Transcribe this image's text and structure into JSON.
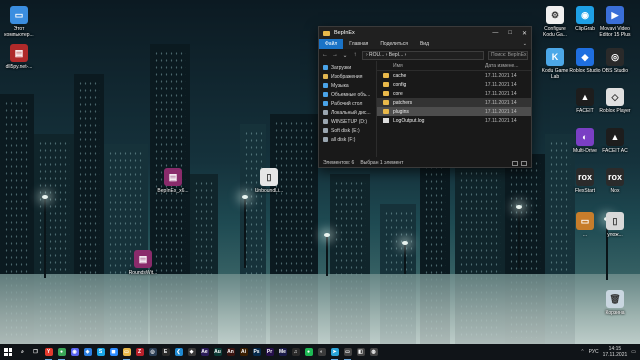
{
  "desktop": {
    "left_icons": [
      {
        "label": "Этот компьютер...",
        "color": "#3b8ee0",
        "glyph": "▭"
      },
      {
        "label": "dll5py.net-...",
        "color": "#b02a2a",
        "glyph": "▤"
      }
    ],
    "middle_icons": [
      {
        "label": "BepInEx_x6...",
        "color": "#8a2b6b",
        "glyph": "▤"
      },
      {
        "label": "UnboundLi...",
        "color": "#e6e6e6",
        "glyph": "▯"
      },
      {
        "label": "RoundsWit...",
        "color": "#8a2b6b",
        "glyph": "▤"
      }
    ],
    "right_icons": [
      {
        "label": "Configure Kodu Ga...",
        "color": "#f0f0f0",
        "glyph": "⚙"
      },
      {
        "label": "ClipGrab",
        "color": "#1ea0e6",
        "glyph": "◉"
      },
      {
        "label": "Movavi Video Editor 15 Plus",
        "color": "#3a6fd8",
        "glyph": "▶"
      },
      {
        "label": "Kodu Game Lab",
        "color": "#4ca8e8",
        "glyph": "K"
      },
      {
        "label": "Roblox Studio",
        "color": "#1f6fe0",
        "glyph": "◆"
      },
      {
        "label": "OBS Studio",
        "color": "#2a2a2a",
        "glyph": "◎"
      },
      {
        "label": "FACEIT",
        "color": "#1d1d1d",
        "glyph": "▲"
      },
      {
        "label": "Roblox Player",
        "color": "#e0e0e0",
        "glyph": "◇"
      },
      {
        "label": "Multi-Drive",
        "color": "#7a3fc4",
        "glyph": "◐"
      },
      {
        "label": "FACEIT AC",
        "color": "#1d1d1d",
        "glyph": "▲"
      },
      {
        "label": "FlexStart",
        "color": "#2b2b2b",
        "glyph": "rox"
      },
      {
        "label": "Nox",
        "color": "#2b2b2b",
        "glyph": "rox"
      },
      {
        "label": "...",
        "color": "#c77d2b",
        "glyph": "▭"
      },
      {
        "label": "улож...",
        "color": "#d8d8d8",
        "glyph": "▯"
      },
      {
        "label": "Корзина",
        "color": "#c9d6e0",
        "glyph": "🗑"
      }
    ]
  },
  "explorer": {
    "title": "BepInEx",
    "window_buttons": [
      "—",
      "□",
      "✕"
    ],
    "ribbon_tabs": [
      "Файл",
      "Главная",
      "Поделиться",
      "Вид"
    ],
    "address": "›  ROU...  ›  BepI...  ›",
    "search_placeholder": "Поиск: BepInEx",
    "nav_items": [
      {
        "label": "Загрузки",
        "color": "#4aa3e8"
      },
      {
        "label": "Изображения",
        "color": "#e2b650"
      },
      {
        "label": "Музыка",
        "color": "#4aa3e8"
      },
      {
        "label": "Объемные объ...",
        "color": "#4aa3e8"
      },
      {
        "label": "Рабочий стол",
        "color": "#4aa3e8"
      },
      {
        "label": "Локальный дис...",
        "color": "#9aa6b0"
      },
      {
        "label": "WINSETUP (D:)",
        "color": "#9aa6b0"
      },
      {
        "label": "Soft disk (E:)",
        "color": "#9aa6b0"
      },
      {
        "label": "all disk (F:)",
        "color": "#9aa6b0"
      }
    ],
    "columns": {
      "name": "Имя",
      "date": "Дата измене..."
    },
    "files": [
      {
        "name": "cache",
        "date": "17.11.2021 14",
        "type": "folder"
      },
      {
        "name": "config",
        "date": "17.11.2021 14",
        "type": "folder"
      },
      {
        "name": "core",
        "date": "17.11.2021 14",
        "type": "folder"
      },
      {
        "name": "patchers",
        "date": "17.11.2021 14",
        "type": "folder"
      },
      {
        "name": "plugins",
        "date": "17.11.2021 14",
        "type": "folder"
      },
      {
        "name": "LogOutput.log",
        "date": "17.11.2021 14",
        "type": "file"
      }
    ],
    "status": {
      "count": "Элементов: 6",
      "selected": "Выбран 1 элемент"
    }
  },
  "taskbar": {
    "apps": [
      {
        "name": "search-icon",
        "color": "#101418",
        "glyph": "⌕"
      },
      {
        "name": "task-view-icon",
        "color": "#101418",
        "glyph": "❐"
      },
      {
        "name": "yandex-browser-icon",
        "color": "#e23a2e",
        "glyph": "Y"
      },
      {
        "name": "chrome-icon",
        "color": "#3aa757",
        "glyph": "●"
      },
      {
        "name": "discord-icon",
        "color": "#5865f2",
        "glyph": "◉"
      },
      {
        "name": "vk-icon",
        "color": "#2d7fe0",
        "glyph": "◈"
      },
      {
        "name": "skype-icon",
        "color": "#1aa7e8",
        "glyph": "S"
      },
      {
        "name": "zoom-icon",
        "color": "#2d8cff",
        "glyph": "◼"
      },
      {
        "name": "file-explorer-icon",
        "color": "#e8b84a",
        "glyph": "▭"
      },
      {
        "name": "filezilla-icon",
        "color": "#b8202a",
        "glyph": "Z"
      },
      {
        "name": "steam-icon",
        "color": "#2b3e55",
        "glyph": "◎"
      },
      {
        "name": "epic-games-icon",
        "color": "#2b2b2b",
        "glyph": "E"
      },
      {
        "name": "vs-code-icon",
        "color": "#1f8ad2",
        "glyph": "❮"
      },
      {
        "name": "unity-icon",
        "color": "#3a3a3a",
        "glyph": "◆"
      },
      {
        "name": "after-effects-icon",
        "color": "#2b1d5a",
        "glyph": "Ae"
      },
      {
        "name": "audition-icon",
        "color": "#0b3a35",
        "glyph": "Au"
      },
      {
        "name": "animate-icon",
        "color": "#3b1410",
        "glyph": "An"
      },
      {
        "name": "illustrator-icon",
        "color": "#3a1e00",
        "glyph": "Ai"
      },
      {
        "name": "photoshop-icon",
        "color": "#062a4c",
        "glyph": "Ps"
      },
      {
        "name": "premiere-icon",
        "color": "#26104b",
        "glyph": "Pr"
      },
      {
        "name": "media-encoder-icon",
        "color": "#1b1b4a",
        "glyph": "Me"
      },
      {
        "name": "audio-icon",
        "color": "#2a2a2a",
        "glyph": "♫"
      },
      {
        "name": "spotify-icon",
        "color": "#1db954",
        "glyph": "●"
      },
      {
        "name": "app-icon",
        "color": "#3b3b3b",
        "glyph": "◐"
      },
      {
        "name": "telegram-icon",
        "color": "#2aa3d8",
        "glyph": "➤"
      },
      {
        "name": "monitor-icon",
        "color": "#444",
        "glyph": "▭"
      },
      {
        "name": "game-icon",
        "color": "#444",
        "glyph": "◧"
      },
      {
        "name": "browser-icon",
        "color": "#444",
        "glyph": "◍"
      }
    ],
    "tray": {
      "language": "РУС",
      "time": "14:15",
      "date": "17.11.2021"
    }
  }
}
